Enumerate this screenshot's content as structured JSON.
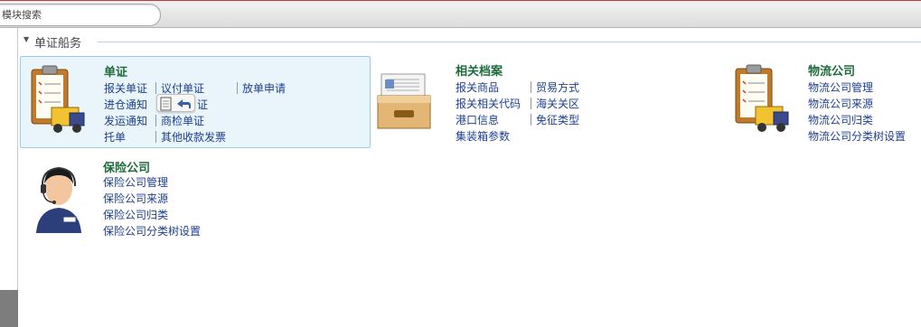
{
  "search": {
    "placeholder": "模块搜索"
  },
  "section": {
    "title": "单证船务"
  },
  "modules": [
    {
      "title": "单证",
      "icon": "clipboard-truck-icon",
      "links": [
        "报关单证",
        "议付单证",
        "放单申请",
        "进仓通知",
        "证",
        "发运通知",
        "商检单证",
        "托单",
        "其他收款发票"
      ]
    },
    {
      "title": "相关档案",
      "icon": "file-drawer-icon",
      "links": [
        "报关商品",
        "贸易方式",
        "报关相关代码",
        "海关关区",
        "港口信息",
        "免征类型",
        "集装箱参数"
      ]
    },
    {
      "title": "物流公司",
      "icon": "clipboard-truck-icon",
      "links": [
        "物流公司管理",
        "物流公司来源",
        "物流公司归类",
        "物流公司分类树设置"
      ]
    },
    {
      "title": "保险公司",
      "icon": "headset-agent-icon",
      "links": [
        "保险公司管理",
        "保险公司来源",
        "保险公司归类",
        "保险公司分类树设置"
      ]
    }
  ],
  "colors": {
    "module_title": "#1d6b3a",
    "link": "#1d3f8f",
    "highlight_bg": "#e9f5fb",
    "top_border": "#c83a3a"
  }
}
